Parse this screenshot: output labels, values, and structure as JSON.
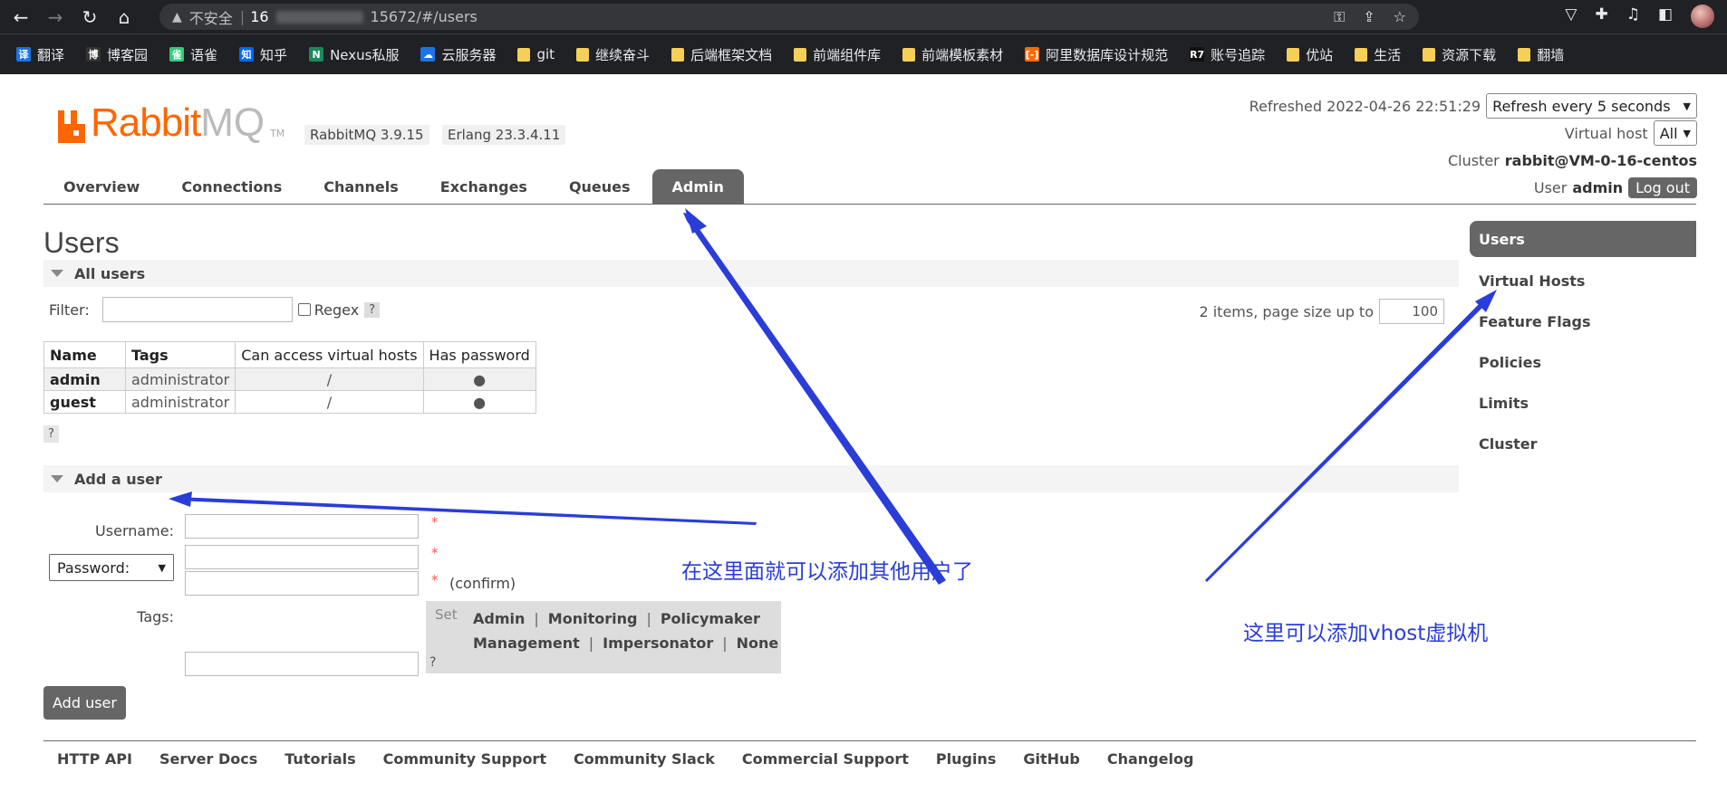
{
  "browser": {
    "security_label": "不安全",
    "url_prefix": "16",
    "url_suffix": "15672/#/users",
    "bookmarks": [
      {
        "label": "翻译",
        "icon": "translate-icon",
        "color": "#1a73e8",
        "glyph": "译"
      },
      {
        "label": "博客园",
        "icon": "cnblogs-icon",
        "color": "#333333",
        "glyph": "博"
      },
      {
        "label": "语雀",
        "icon": "yuque-icon",
        "color": "#31cc79",
        "glyph": "雀"
      },
      {
        "label": "知乎",
        "icon": "zhihu-icon",
        "color": "#0066ff",
        "glyph": "知"
      },
      {
        "label": "Nexus私服",
        "icon": "nexus-icon",
        "color": "#1b8a5a",
        "glyph": "N"
      },
      {
        "label": "云服务器",
        "icon": "cloud-icon",
        "color": "#1a73e8",
        "glyph": "☁"
      },
      {
        "label": "git",
        "icon": "folder-icon",
        "color": "#f6cf57",
        "glyph": ""
      },
      {
        "label": "继续奋斗",
        "icon": "folder-icon",
        "color": "#f6cf57",
        "glyph": ""
      },
      {
        "label": "后端框架文档",
        "icon": "folder-icon",
        "color": "#f6cf57",
        "glyph": ""
      },
      {
        "label": "前端组件库",
        "icon": "folder-icon",
        "color": "#f6cf57",
        "glyph": ""
      },
      {
        "label": "前端模板素材",
        "icon": "folder-icon",
        "color": "#f6cf57",
        "glyph": ""
      },
      {
        "label": "阿里数据库设计规范",
        "icon": "aliyun-icon",
        "color": "#ff6a00",
        "glyph": "[-]"
      },
      {
        "label": "账号追踪",
        "icon": "r7-icon",
        "color": "#111111",
        "glyph": "R7"
      },
      {
        "label": "优站",
        "icon": "folder-icon",
        "color": "#f6cf57",
        "glyph": ""
      },
      {
        "label": "生活",
        "icon": "folder-icon",
        "color": "#f6cf57",
        "glyph": ""
      },
      {
        "label": "资源下载",
        "icon": "folder-icon",
        "color": "#f6cf57",
        "glyph": ""
      },
      {
        "label": "翻墙",
        "icon": "folder-icon",
        "color": "#f6cf57",
        "glyph": ""
      }
    ]
  },
  "header": {
    "logo_rabbit": "Rabbit",
    "logo_mq": "MQ",
    "logo_tm": "TM",
    "version": "RabbitMQ 3.9.15",
    "erlang": "Erlang 23.3.4.11",
    "refreshed_label": "Refreshed 2022-04-26 22:51:29",
    "refresh_select": "Refresh every 5 seconds",
    "vhost_label": "Virtual host",
    "vhost_select": "All",
    "cluster_label": "Cluster",
    "cluster_value": "rabbit@VM-0-16-centos",
    "user_label": "User",
    "user_value": "admin",
    "logout": "Log out"
  },
  "tabs": [
    "Overview",
    "Connections",
    "Channels",
    "Exchanges",
    "Queues",
    "Admin"
  ],
  "main": {
    "title": "Users",
    "all_users": "All users",
    "filter_label": "Filter:",
    "regex_label": "Regex",
    "help": "?",
    "paging_label": "2 items, page size up to",
    "page_size": "100",
    "table": {
      "headers": [
        "Name",
        "Tags",
        "Can access virtual hosts",
        "Has password"
      ],
      "rows": [
        [
          "admin",
          "administrator",
          "/",
          "●"
        ],
        [
          "guest",
          "administrator",
          "/",
          "●"
        ]
      ]
    },
    "add_user": {
      "section": "Add a user",
      "username_label": "Username:",
      "password_select": "Password:",
      "confirm_label": "(confirm)",
      "required_mark": "*",
      "tags_label": "Tags:",
      "set_label": "Set",
      "tags_row1": [
        "Admin",
        "Monitoring",
        "Policymaker"
      ],
      "tags_row2": [
        "Management",
        "Impersonator",
        "None"
      ],
      "submit": "Add user"
    }
  },
  "sidebar": [
    "Users",
    "Virtual Hosts",
    "Feature Flags",
    "Policies",
    "Limits",
    "Cluster"
  ],
  "footer": [
    "HTTP API",
    "Server Docs",
    "Tutorials",
    "Community Support",
    "Community Slack",
    "Commercial Support",
    "Plugins",
    "GitHub",
    "Changelog"
  ],
  "annotations": {
    "add_users_note": "在这里面就可以添加其他用户了",
    "vhost_note": "这里可以添加vhost虚拟机",
    "color": "#2a3dd8"
  }
}
